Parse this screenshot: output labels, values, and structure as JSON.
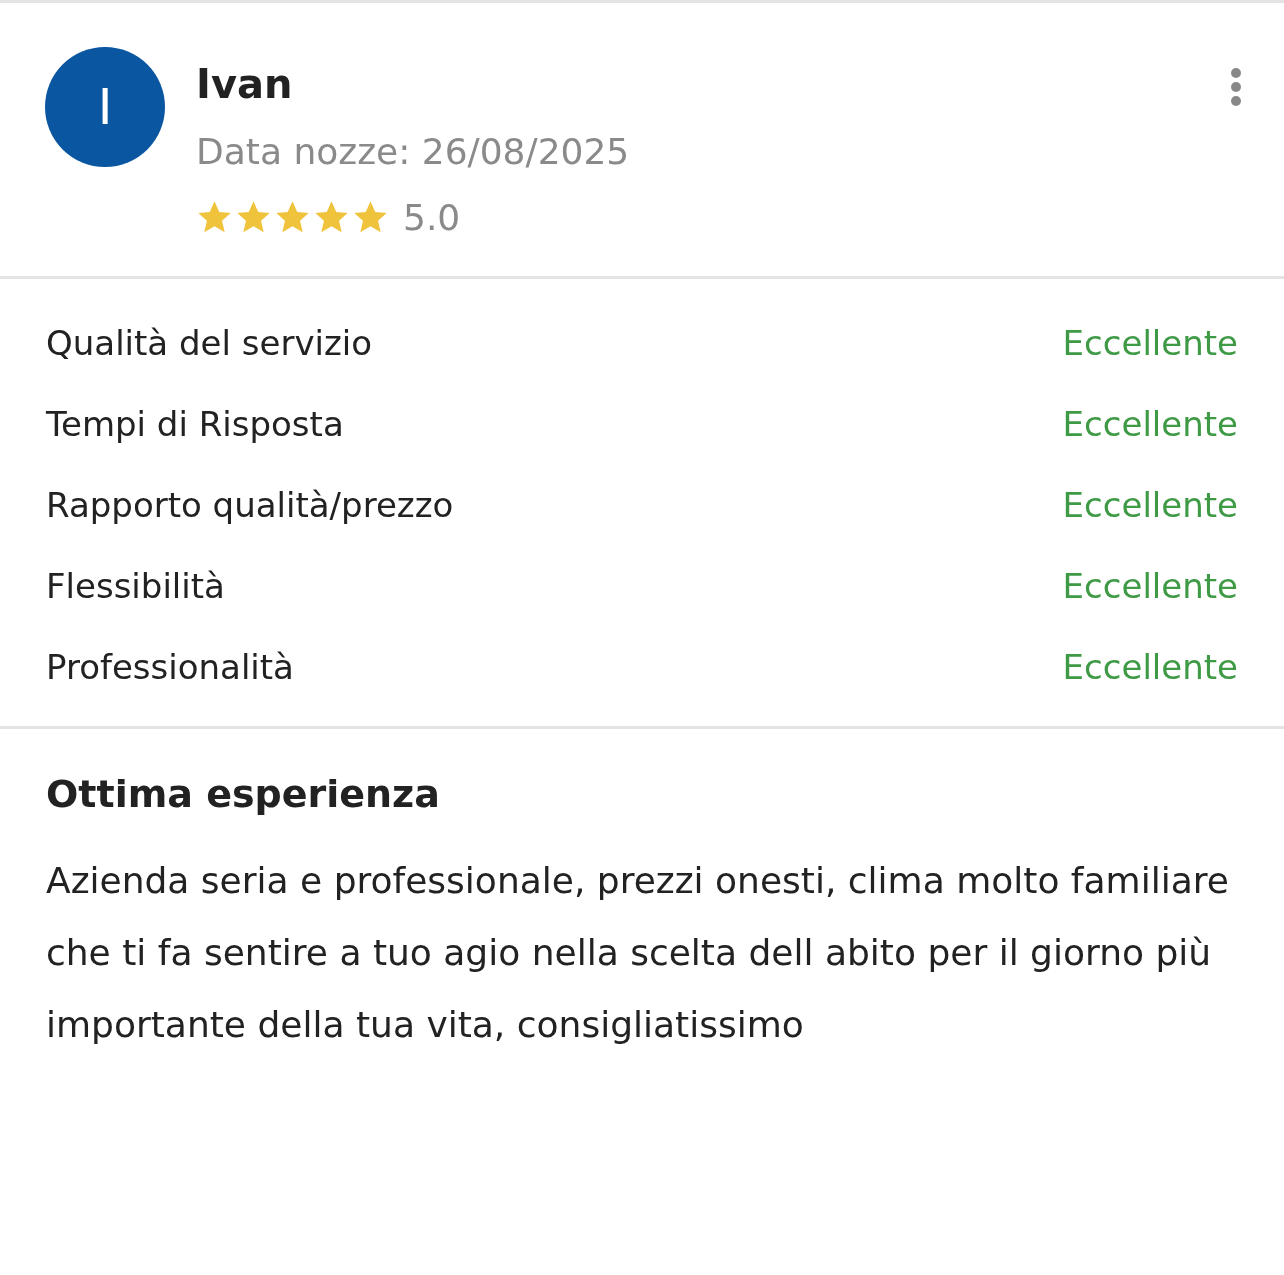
{
  "review": {
    "avatar_letter": "I",
    "name": "Ivan",
    "wedding_date": "Data nozze: 26/08/2025",
    "stars": 5,
    "rating": "5.0"
  },
  "criteria": [
    {
      "label": "Qualità del servizio",
      "value": "Eccellente"
    },
    {
      "label": "Tempi di Risposta",
      "value": "Eccellente"
    },
    {
      "label": "Rapporto qualità/prezzo",
      "value": "Eccellente"
    },
    {
      "label": "Flessibilità",
      "value": "Eccellente"
    },
    {
      "label": "Professionalità",
      "value": "Eccellente"
    }
  ],
  "title": "Ottima esperienza",
  "body": "Azienda seria e professionale, prezzi onesti, clima molto familiare che ti fa sentire a tuo agio nella scelta dell abito per il giorno più importante della tua vita, consigliatissimo"
}
